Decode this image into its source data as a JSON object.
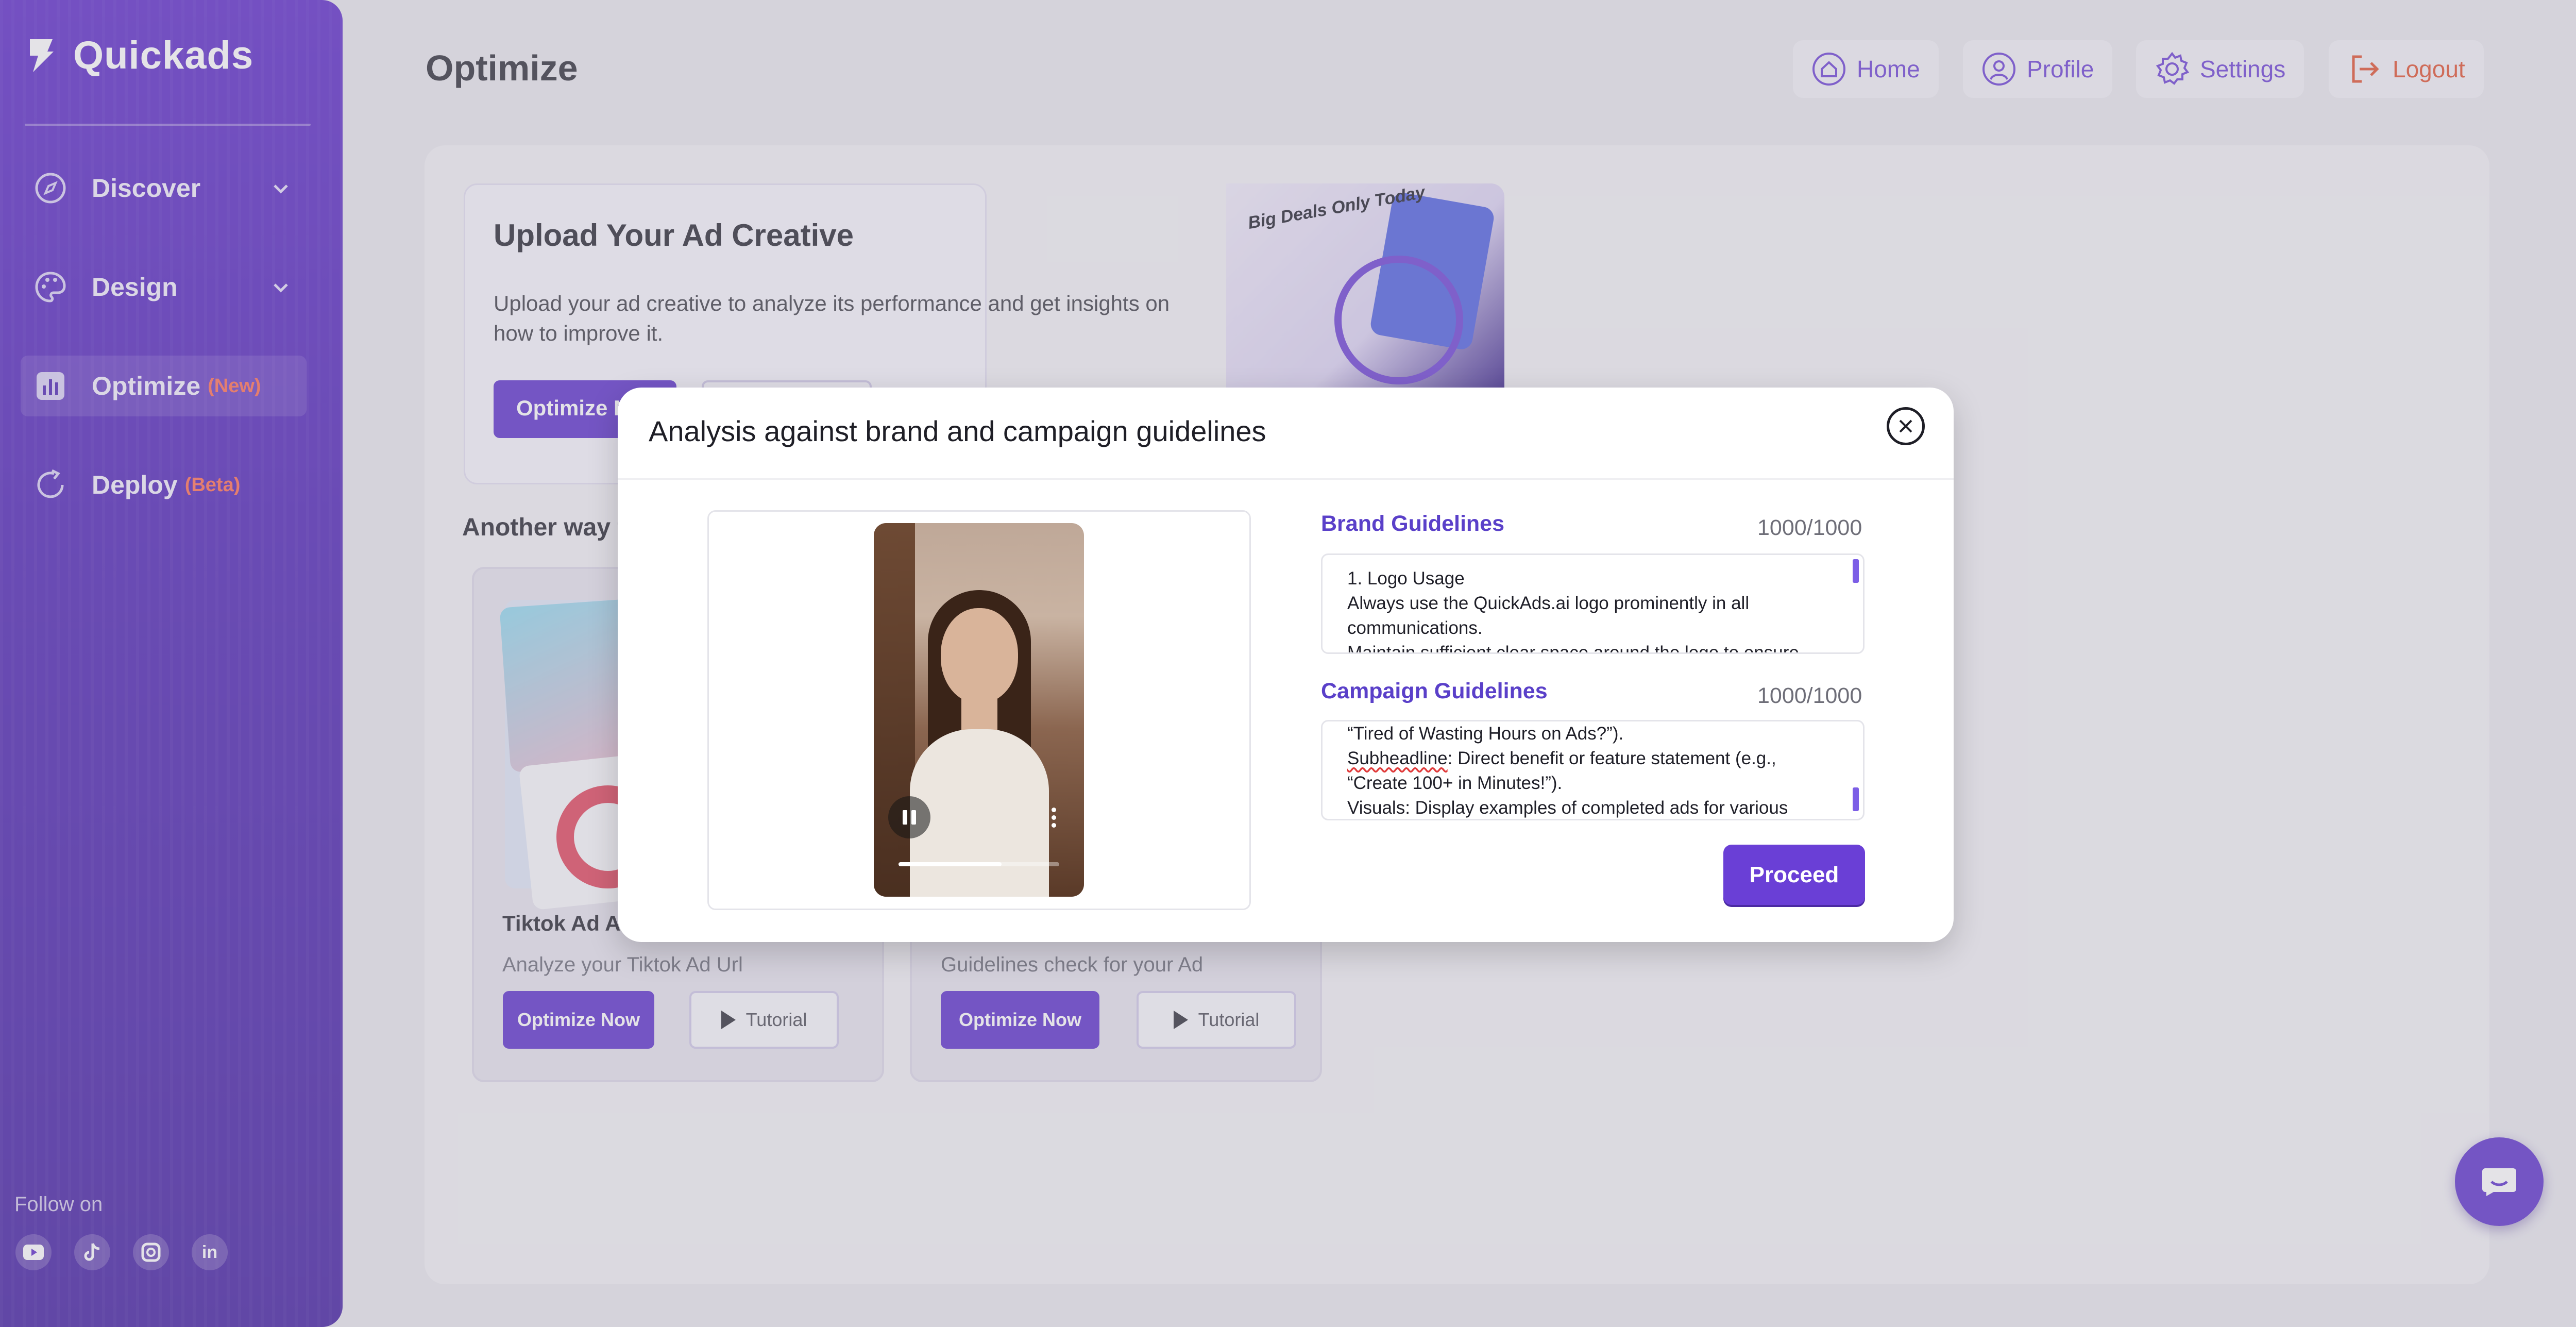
{
  "app": {
    "name": "Quickads"
  },
  "sidebar": {
    "items": [
      {
        "label": "Discover",
        "badge": ""
      },
      {
        "label": "Design",
        "badge": ""
      },
      {
        "label": "Optimize",
        "badge": "(New)"
      },
      {
        "label": "Deploy",
        "badge": "(Beta)"
      }
    ],
    "follow_label": "Follow on",
    "socials": [
      "youtube-icon",
      "tiktok-icon",
      "instagram-icon",
      "linkedin-icon"
    ]
  },
  "header": {
    "title": "Optimize",
    "nav": [
      {
        "label": "Home",
        "icon": "home-icon"
      },
      {
        "label": "Profile",
        "icon": "profile-icon"
      },
      {
        "label": "Settings",
        "icon": "settings-icon"
      },
      {
        "label": "Logout",
        "icon": "logout-icon"
      }
    ]
  },
  "upload": {
    "title": "Upload Your Ad Creative",
    "description": "Upload your ad creative to analyze its performance and get insights on how to improve it.",
    "button": "Optimize N",
    "promo_text": "Big Deals Only Today"
  },
  "another_way": {
    "label": "Another way t"
  },
  "cards": [
    {
      "title": "Tiktok Ad An",
      "subtitle": "Analyze your Tiktok Ad Url",
      "primary": "Optimize Now",
      "secondary": "Tutorial"
    },
    {
      "title": "",
      "subtitle": "Guidelines check for your Ad",
      "primary": "Optimize Now",
      "secondary": "Tutorial"
    }
  ],
  "modal": {
    "title": "Analysis against brand and campaign guidelines",
    "brand": {
      "label": "Brand Guidelines",
      "count": "1000/1000",
      "lines": [
        "1. Logo Usage",
        "Always use the QuickAds.ai logo prominently in all",
        "communications.",
        "Maintain sufficient clear space around the logo to ensure"
      ]
    },
    "campaign": {
      "label": "Campaign Guidelines",
      "count": "1000/1000",
      "line1": "“Tired of Wasting Hours on Ads?”).",
      "line2_word": "Subheadline",
      "line2_rest": ": Direct benefit or feature statement (e.g.,",
      "line3": "“Create 100+ in Minutes!”).",
      "line4": "Visuals: Display examples of completed ads for various"
    },
    "proceed": "Proceed",
    "video_progress": 0.64
  },
  "colors": {
    "accent": "#5a2fcc",
    "logout": "#e0502f",
    "badge": "#ff6a4d"
  }
}
